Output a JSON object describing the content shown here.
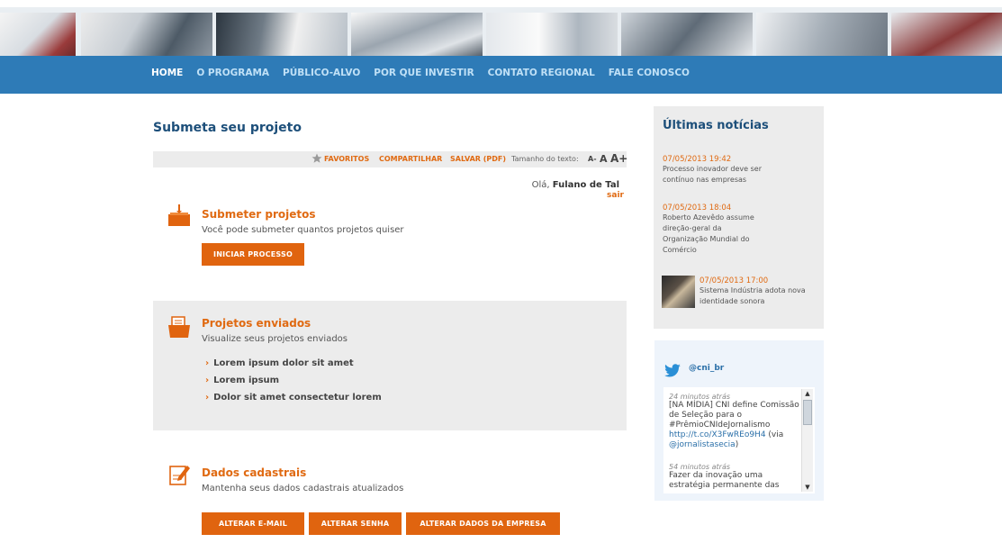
{
  "nav": {
    "items": [
      "HOME",
      "O PROGRAMA",
      "PÚBLICO-ALVO",
      "POR QUE INVESTIR",
      "CONTATO REGIONAL",
      "FALE CONOSCO"
    ]
  },
  "page": {
    "title": "Submeta seu projeto"
  },
  "toolbar": {
    "favorites": "FAVORITOS",
    "share": "COMPARTILHAR",
    "save_pdf": "SALVAR (PDF)",
    "text_size_label": "Tamanho do texto:",
    "a_minus": "A-",
    "a_normal": "A",
    "a_plus": "A+"
  },
  "user": {
    "greeting": "Olá,",
    "name": "Fulano de Tal",
    "logout": "sair"
  },
  "sections": {
    "submit": {
      "title": "Submeter projetos",
      "desc": "Você pode submeter quantos projetos quiser",
      "button": "INICIAR PROCESSO"
    },
    "sent": {
      "title": "Projetos enviados",
      "desc": "Visualize seus projetos enviados",
      "items": [
        "Lorem ipsum dolor sit amet",
        "Lorem ipsum",
        "Dolor sit amet consectetur lorem"
      ]
    },
    "profile": {
      "title": "Dados cadastrais",
      "desc": "Mantenha seus dados cadastrais atualizados",
      "buttons": [
        "ALTERAR E-MAIL",
        "ALTERAR SENHA",
        "ALTERAR DADOS DA EMPRESA"
      ]
    }
  },
  "news": {
    "title": "Últimas notícias",
    "items": [
      {
        "date": "07/05/2013 19:42",
        "text": "Processo inovador deve ser contínuo nas empresas"
      },
      {
        "date": "07/05/2013 18:04",
        "text": "Roberto Azevêdo assume direção-geral da Organização Mundial do Comércio"
      },
      {
        "date": "07/05/2013 17:00",
        "text": "Sistema Indústria adota nova identidade sonora"
      }
    ]
  },
  "twitter": {
    "handle": "@cni_br",
    "tweets": [
      {
        "time": "24 minutos atrás",
        "text": "[NA MÍDIA] CNI define Comissão de Seleção para o #PrêmioCNIdeJornalismo",
        "link": "http://t.co/X3FwREo9H4",
        "via_prefix": "(via",
        "via_handle": "@jornalistasecia",
        "via_suffix": ")"
      },
      {
        "time": "54 minutos atrás",
        "text": "Fazer da inovação uma estratégia permanente das"
      }
    ]
  },
  "colors": {
    "accent": "#e0640f",
    "nav": "#2e7bb7",
    "title": "#1d4f7a"
  }
}
